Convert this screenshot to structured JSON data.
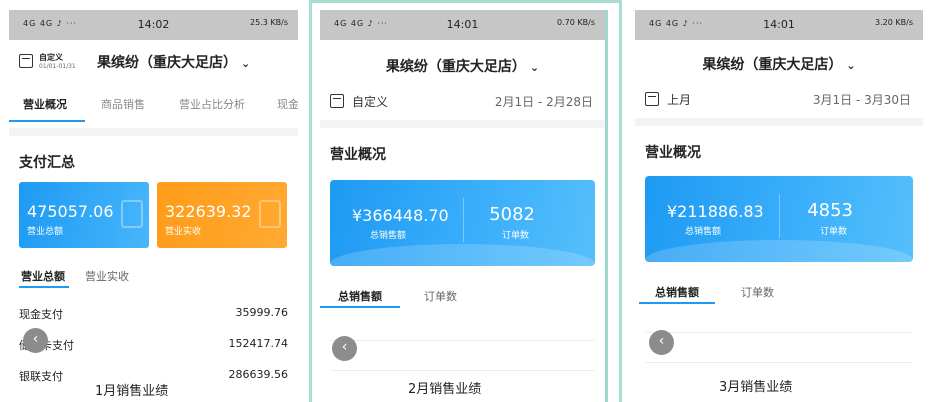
{
  "status": {
    "signal": "4G 4G ♪ ···",
    "panel1_time": "14:02",
    "panel1_stats": "25.3 KB/s",
    "panel2_time": "14:01",
    "panel2_stats": "0.70 KB/s",
    "panel3_time": "14:01",
    "panel3_stats": "3.20 KB/s"
  },
  "panel1": {
    "date_mode": "自定义",
    "date_range": "01/01-01/31",
    "store_name": "果缤纷（重庆大足店）",
    "tabs": [
      "营业概况",
      "商品销售",
      "营业占比分析",
      "现金"
    ],
    "section_title": "支付汇总",
    "cards": [
      {
        "value": "475057.06",
        "label": "营业总额"
      },
      {
        "value": "322639.32",
        "label": "营业实收"
      }
    ],
    "subtabs": [
      "营业总额",
      "营业实收"
    ],
    "payments": [
      {
        "name": "现金支付",
        "value": "35999.76"
      },
      {
        "name": "储值卡支付",
        "value": "152417.74"
      },
      {
        "name": "银联支付",
        "value": "286639.56"
      }
    ],
    "caption": "1月销售业绩"
  },
  "panel2": {
    "store_name": "果缤纷（重庆大足店）",
    "date_mode": "自定义",
    "date_range": "2月1日 - 2月28日",
    "section_title": "营业概况",
    "total_sales": "¥366448.70",
    "total_sales_label": "总销售额",
    "orders": "5082",
    "orders_label": "订单数",
    "tabs": [
      "总销售额",
      "订单数"
    ],
    "caption": "2月销售业绩"
  },
  "panel3": {
    "store_name": "果缤纷（重庆大足店）",
    "date_mode": "上月",
    "date_range": "3月1日 - 3月30日",
    "section_title": "营业概况",
    "total_sales": "¥211886.83",
    "total_sales_label": "总销售额",
    "orders": "4853",
    "orders_label": "订单数",
    "tabs": [
      "总销售额",
      "订单数"
    ],
    "caption": "3月销售业绩"
  },
  "icons": {
    "chevron": "⌄",
    "back": "‹"
  }
}
